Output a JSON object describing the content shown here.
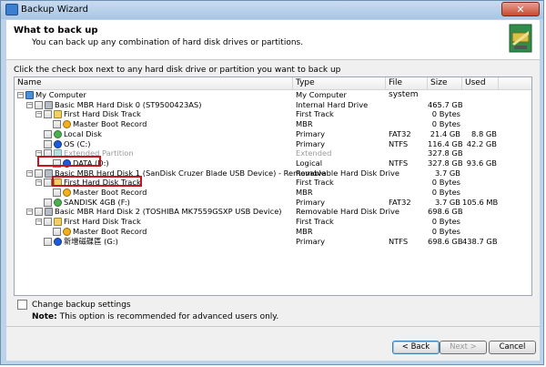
{
  "window": {
    "title": "Backup Wizard",
    "close_glyph": "✕"
  },
  "header": {
    "title": "What to back up",
    "subtitle": "You can back up any combination of hard disk drives or partitions."
  },
  "instruction": "Click the check box next to any hard disk drive or partition you want to back up",
  "columns": {
    "name": "Name",
    "type": "Type",
    "fs": "File system",
    "size": "Size",
    "used": "Used"
  },
  "rows": [
    {
      "label": "My Computer",
      "type": "My Computer",
      "fs": "",
      "size": "",
      "used": "",
      "icon": "computer-icon"
    },
    {
      "label": "Basic MBR Hard Disk 0 (ST9500423AS)",
      "type": "Internal Hard Drive",
      "fs": "",
      "size": "465.7 GB",
      "used": "",
      "icon": "hard-disk-icon"
    },
    {
      "label": "First Hard Disk Track",
      "type": "First Track",
      "fs": "",
      "size": "0 Bytes",
      "used": "",
      "icon": "track-icon"
    },
    {
      "label": "Master Boot Record",
      "type": "MBR",
      "fs": "",
      "size": "0 Bytes",
      "used": "",
      "icon": "mbr-icon"
    },
    {
      "label": "Local Disk",
      "type": "Primary",
      "fs": "FAT32",
      "size": "21.4 GB",
      "used": "8.8 GB",
      "icon": "partition-icon"
    },
    {
      "label": "OS (C:)",
      "type": "Primary",
      "fs": "NTFS",
      "size": "116.4 GB",
      "used": "42.2 GB",
      "icon": "partition-icon"
    },
    {
      "label": "Extended Partition",
      "type": "Extended",
      "fs": "",
      "size": "327.8 GB",
      "used": "",
      "icon": "extended-partition-icon"
    },
    {
      "label": "DATA (D:)",
      "type": "Logical",
      "fs": "NTFS",
      "size": "327.8 GB",
      "used": "93.6 GB",
      "icon": "partition-icon"
    },
    {
      "label": "Basic MBR Hard Disk 1 (SanDisk Cruzer Blade USB Device) - Removable",
      "type": "Removable Hard Disk Drive",
      "fs": "",
      "size": "3.7 GB",
      "used": "",
      "icon": "hard-disk-icon"
    },
    {
      "label": "First Hard Disk Track",
      "type": "First Track",
      "fs": "",
      "size": "0 Bytes",
      "used": "",
      "icon": "track-icon"
    },
    {
      "label": "Master Boot Record",
      "type": "MBR",
      "fs": "",
      "size": "0 Bytes",
      "used": "",
      "icon": "mbr-icon"
    },
    {
      "label": "SANDISK 4GB (F:)",
      "type": "Primary",
      "fs": "FAT32",
      "size": "3.7 GB",
      "used": "105.6 MB",
      "icon": "partition-icon"
    },
    {
      "label": "Basic MBR Hard Disk 2 (TOSHIBA MK7559GSXP USB Device)",
      "type": "Removable Hard Disk Drive",
      "fs": "",
      "size": "698.6 GB",
      "used": "",
      "icon": "hard-disk-icon"
    },
    {
      "label": "First Hard Disk Track",
      "type": "First Track",
      "fs": "",
      "size": "0 Bytes",
      "used": "",
      "icon": "track-icon"
    },
    {
      "label": "Master Boot Record",
      "type": "MBR",
      "fs": "",
      "size": "0 Bytes",
      "used": "",
      "icon": "mbr-icon"
    },
    {
      "label": "新增磁碟區 (G:)",
      "type": "Primary",
      "fs": "NTFS",
      "size": "698.6 GB",
      "used": "438.7 GB",
      "icon": "partition-icon"
    }
  ],
  "options": {
    "change_settings_label": "Change backup settings",
    "note_label": "Note:",
    "note_text": "This option is recommended for advanced users only."
  },
  "buttons": {
    "back": "< Back",
    "next": "Next >",
    "cancel": "Cancel"
  }
}
